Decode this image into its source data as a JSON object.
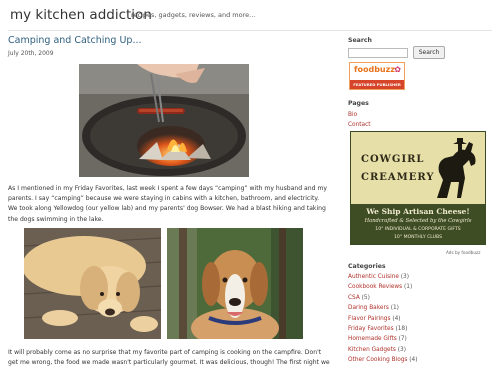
{
  "header": {
    "site_title": "my kitchen addiction",
    "tagline": "recipes, gadgets, reviews, and more..."
  },
  "post": {
    "title": "Camping and Catching Up...",
    "date": "July 20th, 2009",
    "paragraph1": "As I mentioned in my Friday Favorites, last week I spent a few days “camping” with my husband and my parents. I say “camping” because we were staying in cabins with a kitchen, bathroom, and electricity. We took along Yellowdog (our yellow lab) and my parents' dog Bowser. We had a blast hiking and taking the dogs swimming in the lake.",
    "paragraph2": "It will probably come as no surprise that my favorite part of camping is cooking on the campfire. Don't get me wrong, the food we made wasn't particularly gourmet. It was delicious, though! The first night we had"
  },
  "sidebar": {
    "search_heading": "Search",
    "search_input_value": "",
    "search_button": "Search",
    "foodbuzz": {
      "name": "foodbuzz",
      "label": "FEATURED PUBLISHER"
    },
    "pages_heading": "Pages",
    "pages": [
      {
        "label": "Bio"
      },
      {
        "label": "Contact"
      }
    ],
    "ad": {
      "line1": "COWGIRL",
      "line2": "CREAMERY",
      "cta": "We Ship Artisan Cheese!",
      "sub": "Handcrafted & Selected by the Cowgirls",
      "offer1": "10° INDIVIDUAL & CORPORATE GIFTS",
      "offer2": "10° MONTHLY CLUBS",
      "ads_by": "Ads by foodbuzz"
    },
    "categories_heading": "Categories",
    "categories": [
      {
        "name": "Authentic Cuisine",
        "count": "(3)"
      },
      {
        "name": "Cookbook Reviews",
        "count": "(1)"
      },
      {
        "name": "CSA",
        "count": "(5)"
      },
      {
        "name": "Daring Bakers",
        "count": "(1)"
      },
      {
        "name": "Flavor Pairings",
        "count": "(4)"
      },
      {
        "name": "Friday Favorites",
        "count": "(18)"
      },
      {
        "name": "Homemade Gifts",
        "count": "(7)"
      },
      {
        "name": "Kitchen Gadgets",
        "count": "(3)"
      },
      {
        "name": "Other Cooking Blogs",
        "count": "(4)"
      }
    ]
  },
  "colors": {
    "link": "#b0302a",
    "title": "#2f5f7f",
    "foodbuzz_orange": "#e8731c",
    "ad_green": "#3e4d24"
  }
}
